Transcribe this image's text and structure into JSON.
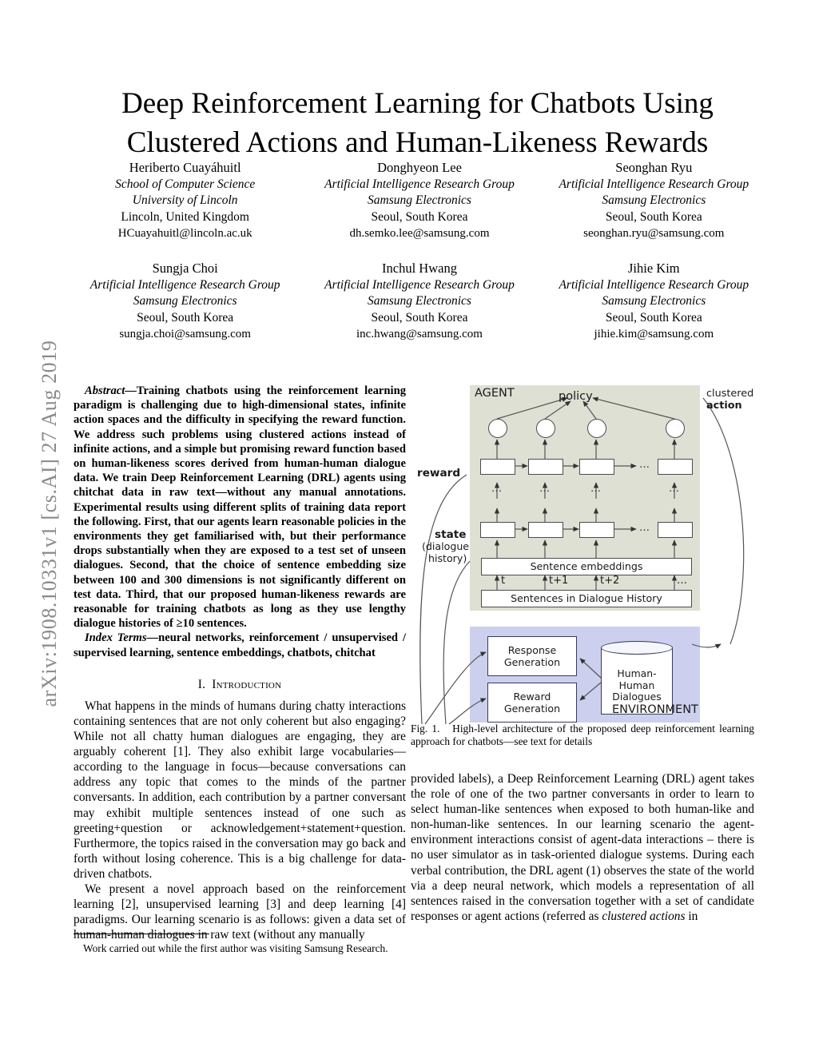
{
  "arxiv_stamp": "arXiv:1908.10331v1  [cs.AI]  27 Aug 2019",
  "title": {
    "line1": "Deep Reinforcement Learning for Chatbots Using",
    "line2": "Clustered Actions and Human-Likeness Rewards"
  },
  "authors": [
    {
      "name": "Heriberto Cuayáhuitl",
      "aff1": "School of Computer Science",
      "aff2": "University of Lincoln",
      "location": "Lincoln, United Kingdom",
      "email": "HCuayahuitl@lincoln.ac.uk"
    },
    {
      "name": "Donghyeon Lee",
      "aff1": "Artificial Intelligence Research Group",
      "aff2": "Samsung Electronics",
      "location": "Seoul, South Korea",
      "email": "dh.semko.lee@samsung.com"
    },
    {
      "name": "Seonghan Ryu",
      "aff1": "Artificial Intelligence Research Group",
      "aff2": "Samsung Electronics",
      "location": "Seoul, South Korea",
      "email": "seonghan.ryu@samsung.com"
    },
    {
      "name": "Sungja Choi",
      "aff1": "Artificial Intelligence Research Group",
      "aff2": "Samsung Electronics",
      "location": "Seoul, South Korea",
      "email": "sungja.choi@samsung.com"
    },
    {
      "name": "Inchul Hwang",
      "aff1": "Artificial Intelligence Research Group",
      "aff2": "Samsung Electronics",
      "location": "Seoul, South Korea",
      "email": "inc.hwang@samsung.com"
    },
    {
      "name": "Jihie Kim",
      "aff1": "Artificial Intelligence Research Group",
      "aff2": "Samsung Electronics",
      "location": "Seoul, South Korea",
      "email": "jihie.kim@samsung.com"
    }
  ],
  "abstract": {
    "lead": "Abstract",
    "dash": "—",
    "body": "Training chatbots using the reinforcement learning paradigm is challenging due to high-dimensional states, infinite action spaces and the difficulty in specifying the reward function. We address such problems using clustered actions instead of infinite actions, and a simple but promising reward function based on human-likeness scores derived from human-human dialogue data. We train Deep Reinforcement Learning (DRL) agents using chitchat data in raw text—without any manual annotations. Experimental results using different splits of training data report the following. First, that our agents learn reasonable policies in the environments they get familiarised with, but their performance drops substantially when they are exposed to a test set of unseen dialogues. Second, that the choice of sentence embedding size between 100 and 300 dimensions is not significantly different on test data. Third, that our proposed human-likeness rewards are reasonable for training chatbots as long as they use lengthy dialogue histories of ≥10 sentences."
  },
  "index_terms": {
    "lead": "Index Terms",
    "dash": "—",
    "body": "neural networks, reinforcement / unsupervised / supervised learning, sentence embeddings, chatbots, chitchat"
  },
  "sections": {
    "intro": {
      "number": "I.",
      "name": "Introduction",
      "para1": "What happens in the minds of humans during chatty interactions containing sentences that are not only coherent but also engaging? While not all chatty human dialogues are engaging, they are arguably coherent [1]. They also exhibit large vocabularies—according to the language in focus—because conversations can address any topic that comes to the minds of the partner conversants. In addition, each contribution by a partner conversant may exhibit multiple sentences instead of one such as greeting+question or acknowledgement+statement+question. Furthermore, the topics raised in the conversation may go back and forth without losing coherence. This is a big challenge for data-driven chatbots.",
      "para2": "We present a novel approach based on the reinforcement learning [2], unsupervised learning [3] and deep learning [4] paradigms. Our learning scenario is as follows: given a data set of human-human dialogues in raw text (without any manually",
      "para2_cont_a": "provided labels), a Deep Reinforcement Learning (DRL) agent takes the role of one of the two partner conversants in order to learn to select human-like sentences when exposed to both human-like and non-human-like sentences. In our learning scenario the agent-environment interactions consist of agent-data interactions – there is no user simulator as in task-oriented dialogue systems. During each verbal contribution, the DRL agent (1) observes the state of the world via a deep neural network, which models a representation of all sentences raised in the conversation together with a set of candidate responses or agent actions (referred as ",
      "para2_cont_italic": "clustered actions",
      "para2_cont_b": " in"
    }
  },
  "footnote": "Work carried out while the first author was visiting Samsung Research.",
  "figure": {
    "caption_label": "Fig. 1.",
    "caption_text": "High-level architecture of the proposed deep reinforcement learning approach for chatbots—see text for details",
    "labels": {
      "agent": "AGENT",
      "environment": "ENVIRONMENT",
      "policy": "policy",
      "clustered": "clustered",
      "action": "action",
      "reward": "reward",
      "state": "state",
      "dialogue": "(dialogue",
      "history": "history)",
      "sentence_embeddings": "Sentence embeddings",
      "sentences_history": "Sentences in Dialogue History",
      "response_generation": "Response\nGeneration",
      "response_generation_l1": "Response",
      "response_generation_l2": "Generation",
      "reward_generation_l1": "Reward",
      "reward_generation_l2": "Generation",
      "db_l1": "Human-",
      "db_l2": "Human",
      "db_l3": "Dialogues",
      "ticks": [
        "t",
        "t+1",
        "t+2",
        "…"
      ],
      "ellipsis": "…"
    },
    "colors": {
      "agent_bg": "#dde0d3",
      "env_bg": "#ccd0ee",
      "stroke": "#4c4c4c",
      "box_stroke": "#3a3a5a"
    }
  }
}
